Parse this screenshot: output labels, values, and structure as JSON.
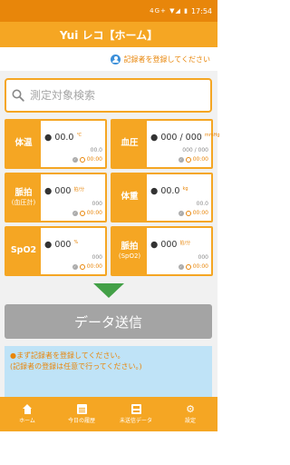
{
  "status": {
    "signal": "4G+ ▼◢ ▮",
    "time": "17:54"
  },
  "app": {
    "title": "Yui レコ【ホーム】"
  },
  "register": {
    "text": "記録者を登録してください"
  },
  "search": {
    "placeholder": "測定対象検索"
  },
  "cards": [
    {
      "label": "体温",
      "sub": "",
      "value": "00.0",
      "unit": "℃",
      "prev": "00.0",
      "time": "00:00"
    },
    {
      "label": "血圧",
      "sub": "",
      "value": "000 / 000",
      "unit": "mmHg",
      "prev": "000 / 000",
      "time": "00:00"
    },
    {
      "label": "脈拍",
      "sub": "(血圧計)",
      "value": "000",
      "unit": "拍/分",
      "prev": "000",
      "time": "00:00"
    },
    {
      "label": "体重",
      "sub": "",
      "value": "00.0",
      "unit": "kg",
      "prev": "00.0",
      "time": "00:00"
    },
    {
      "label": "SpO2",
      "sub": "",
      "value": "000",
      "unit": "%",
      "prev": "000",
      "time": "00:00"
    },
    {
      "label": "脈拍",
      "sub": "(SpO2)",
      "value": "000",
      "unit": "拍/分",
      "prev": "000",
      "time": "00:00"
    }
  ],
  "send_button": "データ送信",
  "notice": {
    "line1": "●まず記録者を登録してください。",
    "line2": "(記録者の登録は任意で行ってください。)"
  },
  "tabs": [
    {
      "label": "ホーム",
      "icon": "home-icon"
    },
    {
      "label": "今日の履歴",
      "icon": "clipboard-icon"
    },
    {
      "label": "未送信データ",
      "icon": "inbox-icon"
    },
    {
      "label": "設定",
      "icon": "gear-icon"
    }
  ],
  "colors": {
    "accent": "#f5a623",
    "status_bar": "#e8860a",
    "arrow": "#43a047",
    "notice_bg": "#bfe3f7"
  }
}
